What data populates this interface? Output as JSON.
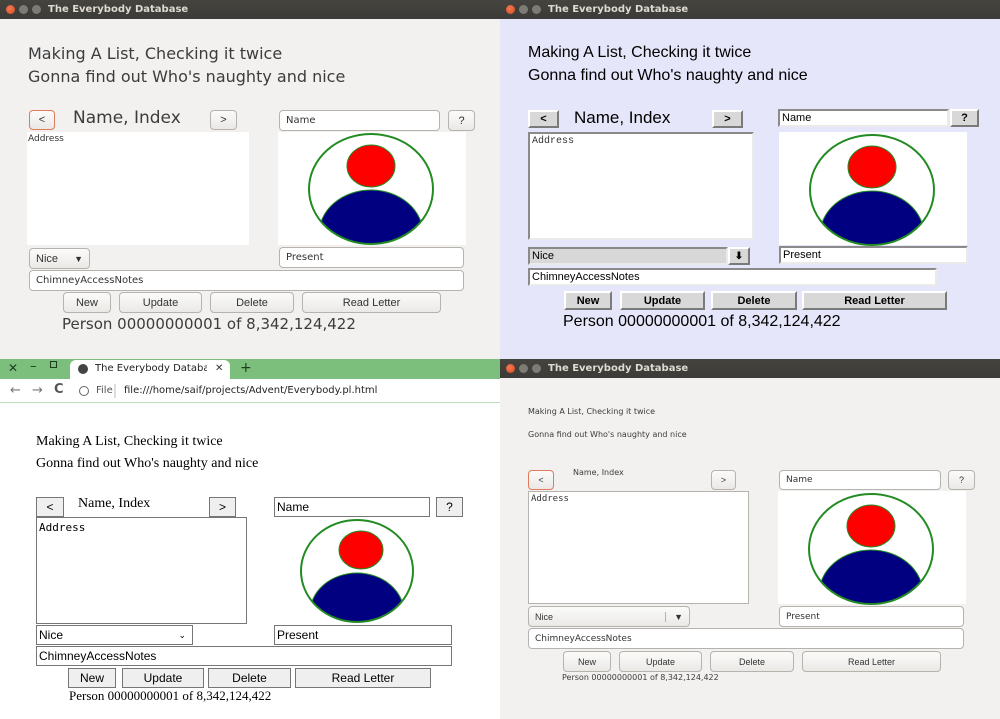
{
  "window_title": "The Everybody Database",
  "heading_line1": "Making A List, Checking it twice",
  "heading_line2": "Gonna find out Who's naughty and nice",
  "nav": {
    "prev_label": "<",
    "title": "Name, Index",
    "next_label": ">"
  },
  "name_field": {
    "value": "Name"
  },
  "help_button": "?",
  "address": {
    "value": "Address"
  },
  "status_select": {
    "selected": "Nice"
  },
  "present_field": {
    "value": "Present"
  },
  "chimney_field": {
    "value": "ChimneyAccessNotes"
  },
  "buttons": {
    "new": "New",
    "update": "Update",
    "delete": "Delete",
    "read_letter": "Read Letter"
  },
  "person_status": "Person 00000000001 of 8,342,124,422",
  "browser": {
    "tab_title": "The Everybody Database",
    "new_tab": "+",
    "file_label": "File",
    "url": "file:///home/saif/projects/Advent/Everybody.pl.html"
  },
  "icons": {
    "avatar": "person-avatar-icon",
    "dropdown": "chevron-down-icon",
    "info": "info-icon",
    "back": "back-arrow-icon",
    "forward": "forward-arrow-icon",
    "reload": "reload-icon"
  },
  "colors": {
    "avatar_head": "#ff0000",
    "avatar_body": "#000080",
    "avatar_ring": "#228b22",
    "gtk_titlebar": "#3c3b37",
    "motif_background": "#e6e6fa",
    "browser_tabbar": "#7cbf7c"
  }
}
